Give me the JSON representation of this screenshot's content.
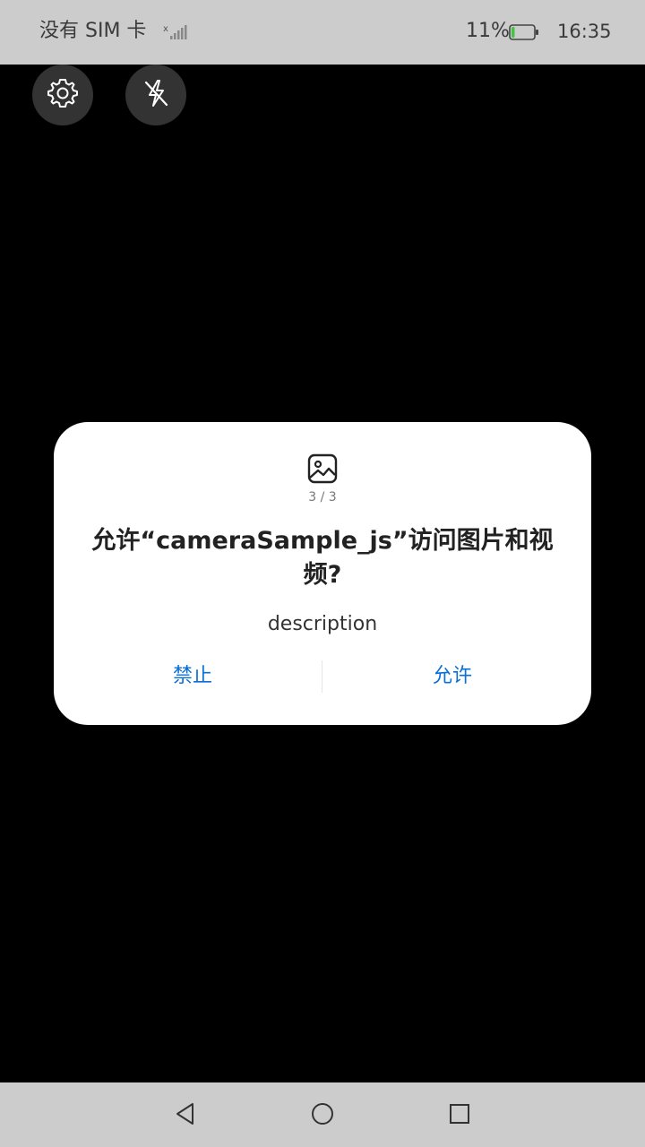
{
  "status_bar": {
    "carrier": "没有 SIM 卡",
    "battery_percent": "11%",
    "time": "16:35",
    "battery_level": 0.11
  },
  "camera_controls": {
    "icons": [
      "gear-icon",
      "flash-off-icon"
    ]
  },
  "dialog": {
    "icon": "image-icon",
    "page_indicator": "3 / 3",
    "title": "允许“cameraSample_js”访问图片和视频?",
    "description": "description",
    "deny_label": "禁止",
    "allow_label": "允许"
  },
  "nav_bar": {
    "icons": [
      "back-icon",
      "home-icon",
      "recent-apps-icon"
    ]
  },
  "colors": {
    "status_bar_bg": "#cccccc",
    "background": "#000000",
    "dialog_bg": "#ffffff",
    "accent": "#0a6fd6",
    "battery_fill": "#3ec63e"
  }
}
